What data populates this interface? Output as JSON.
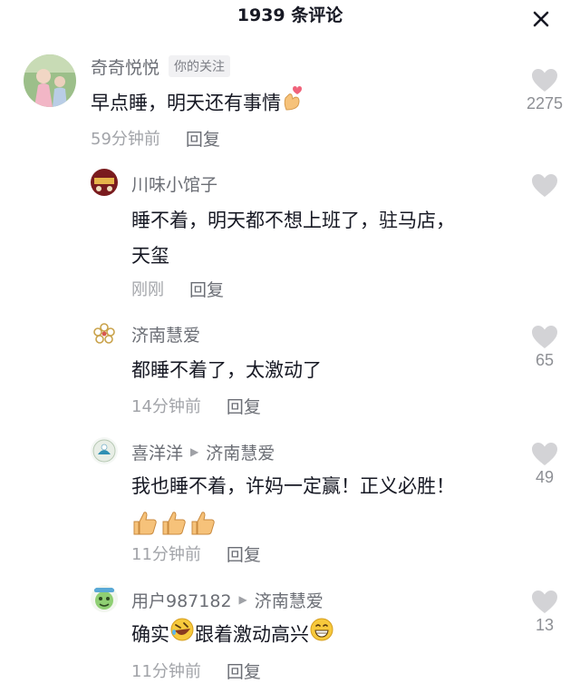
{
  "header": {
    "title": "1939 条评论",
    "close_icon": "close-icon"
  },
  "comments": [
    {
      "author": "奇奇悦悦",
      "badge": "你的关注",
      "text": "早点睡，明天还有事情",
      "emoji": "finger-heart-emoji",
      "time": "59分钟前",
      "reply_label": "回复",
      "likes": "2275"
    },
    {
      "author": "川味小馆子",
      "text_line1": "睡不着，明天都不想上班了，驻马店，",
      "text_line2": "天玺",
      "time": "刚刚",
      "reply_label": "回复",
      "likes": ""
    },
    {
      "author": "济南慧爱",
      "text": "都睡不着了，太激动了",
      "time": "14分钟前",
      "reply_label": "回复",
      "likes": "65"
    },
    {
      "author": "喜洋洋",
      "reply_to": "济南慧爱",
      "text": "我也睡不着，许妈一定赢！正义必胜！",
      "emoji": "thumbs-up-emoji",
      "time": "11分钟前",
      "reply_label": "回复",
      "likes": "49"
    },
    {
      "author": "用户987182",
      "reply_to": "济南慧爱",
      "text_part1": "确实",
      "emoji1": "rofl-emoji",
      "text_part2": "跟着激动高兴",
      "emoji2": "grin-emoji",
      "time": "11分钟前",
      "reply_label": "回复",
      "likes": "13"
    }
  ],
  "colors": {
    "like_heart": "#d3d3d6",
    "meta": "#a2a4a9",
    "author": "#6b6e75"
  }
}
